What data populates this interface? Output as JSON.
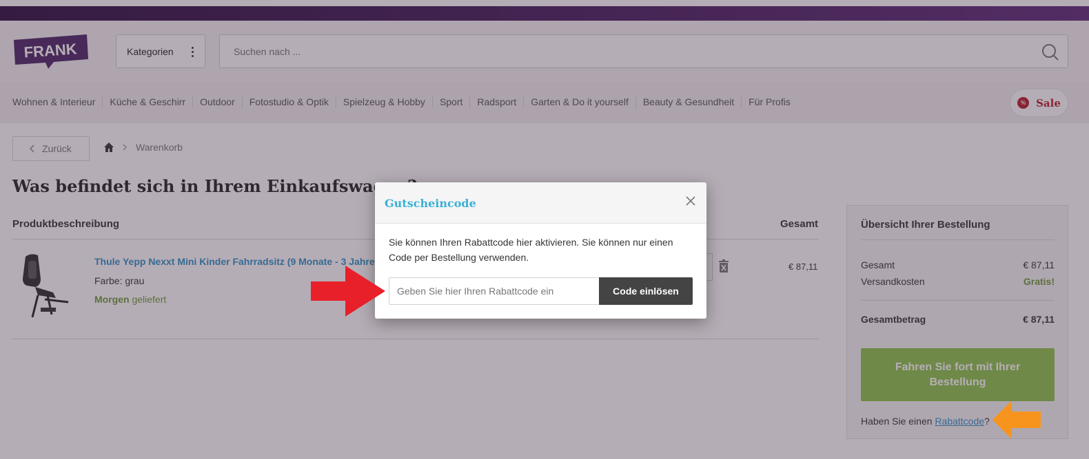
{
  "header": {
    "logo_text": "FRANK",
    "categories_label": "Kategorien",
    "search_placeholder": "Suchen nach ..."
  },
  "nav": {
    "items": [
      "Wohnen & Interieur",
      "Küche & Geschirr",
      "Outdoor",
      "Fotostudio & Optik",
      "Spielzeug & Hobby",
      "Sport",
      "Radsport",
      "Garten & Do it yourself",
      "Beauty & Gesundheit",
      "Für Profis"
    ],
    "sale_label": "Sale",
    "sale_badge": "%"
  },
  "breadcrumb": {
    "back_label": "Zurück",
    "current": "Warenkorb"
  },
  "page_title": "Was befindet sich in Ihrem Einkaufswagen?",
  "cart": {
    "col_description": "Produktbeschreibung",
    "col_total": "Gesamt",
    "item": {
      "name": "Thule Yepp Nexxt Mini Kinder Fahrradsitz (9 Monate - 3 Jahre)",
      "color": "Farbe: grau",
      "delivery_bold": "Morgen",
      "delivery_rest": " geliefert",
      "price": "€ 87,11"
    }
  },
  "summary": {
    "title": "Übersicht Ihrer Bestellung",
    "subtotal_label": "Gesamt",
    "subtotal_value": "€ 87,11",
    "shipping_label": "Versandkosten",
    "shipping_value": "Gratis!",
    "total_label": "Gesamtbetrag",
    "total_value": "€ 87,11",
    "checkout_label": "Fahren Sie fort mit Ihrer Bestellung",
    "coupon_prefix": "Haben Sie einen ",
    "coupon_link": "Rabattcode",
    "coupon_suffix": "?"
  },
  "modal": {
    "title": "Gutscheincode",
    "text": "Sie können Ihren Rabattcode hier aktivieren. Sie können nur einen Code per Bestellung verwenden.",
    "input_placeholder": "Geben Sie hier Ihren Rabattcode ein",
    "button_label": "Code einlösen"
  },
  "colors": {
    "brand_purple": "#4a2366",
    "link_blue": "#2d8fc7",
    "checkout_green": "#8bc34a",
    "sale_red": "#b51d2a",
    "modal_title_cyan": "#3ab0d6",
    "arrow_red": "#e8202a",
    "arrow_orange": "#f7941d"
  },
  "icons": {
    "search": "search-icon",
    "home": "home-icon",
    "back": "chevron-left-icon",
    "close": "close-icon",
    "trash": "trash-icon"
  }
}
